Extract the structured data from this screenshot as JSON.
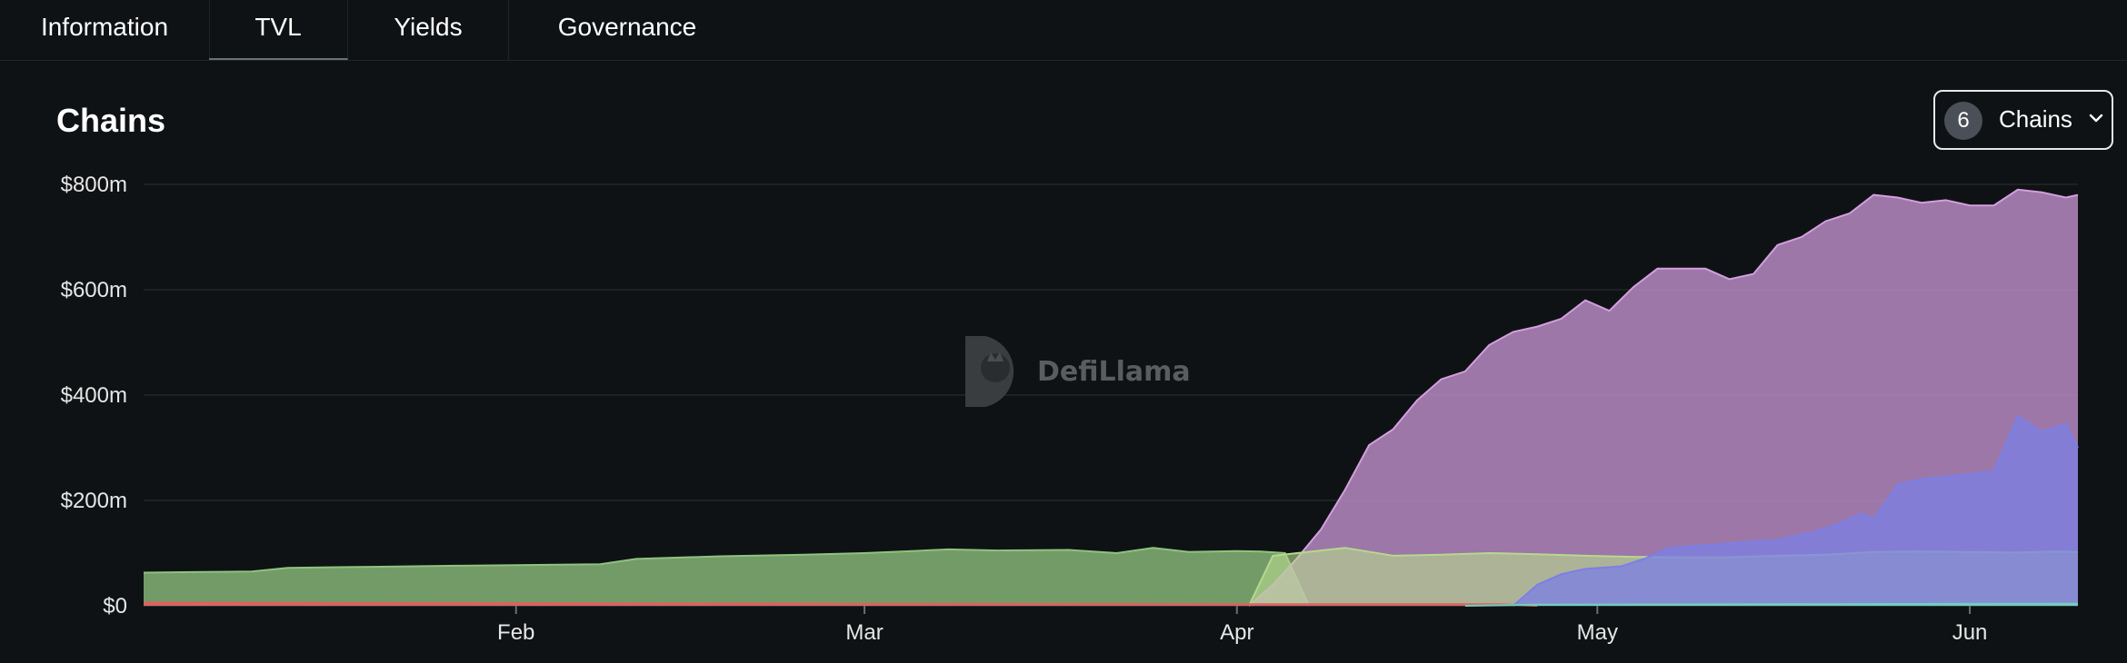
{
  "tabs": [
    {
      "label": "Information",
      "active": false
    },
    {
      "label": "TVL",
      "active": true
    },
    {
      "label": "Yields",
      "active": false
    },
    {
      "label": "Governance",
      "active": false
    }
  ],
  "chart_title": "Chains",
  "chains_selector": {
    "count": "6",
    "label": "Chains",
    "icon": "chevron-down-icon"
  },
  "watermark": "DefiLlama",
  "colors": {
    "background": "#0f1214",
    "grid": "#23272a",
    "series_green": "#8fc27f",
    "series_pink": "#d49ee0",
    "series_blue": "#7b7fe6",
    "series_lightgreen": "#b6d88e",
    "series_red": "#e06060",
    "series_teal": "#6fd0c0"
  },
  "chart_data": {
    "type": "area",
    "stacked": false,
    "x_axis": {
      "start": "2024-01-01",
      "end": "2024-06-10",
      "ticks": [
        "Feb",
        "Mar",
        "Apr",
        "May",
        "Jun"
      ],
      "tick_dates": [
        "2024-02-01",
        "2024-03-01",
        "2024-04-01",
        "2024-05-01",
        "2024-06-01"
      ]
    },
    "y_axis": {
      "ticks": [
        "$0",
        "$200m",
        "$400m",
        "$600m",
        "$800m"
      ],
      "tick_values": [
        0,
        200,
        400,
        600,
        800
      ],
      "units": "USD millions",
      "ylim": [
        0,
        800
      ]
    },
    "grid": true,
    "series": [
      {
        "color": "green",
        "points": [
          [
            "2024-01-01",
            63
          ],
          [
            "2024-01-05",
            64
          ],
          [
            "2024-01-10",
            65
          ],
          [
            "2024-01-13",
            72
          ],
          [
            "2024-01-20",
            74
          ],
          [
            "2024-01-27",
            76
          ],
          [
            "2024-02-01",
            77
          ],
          [
            "2024-02-08",
            79
          ],
          [
            "2024-02-11",
            89
          ],
          [
            "2024-02-18",
            94
          ],
          [
            "2024-02-25",
            97
          ],
          [
            "2024-03-01",
            100
          ],
          [
            "2024-03-05",
            104
          ],
          [
            "2024-03-08",
            107
          ],
          [
            "2024-03-12",
            105
          ],
          [
            "2024-03-18",
            106
          ],
          [
            "2024-03-22",
            100
          ],
          [
            "2024-03-25",
            110
          ],
          [
            "2024-03-28",
            102
          ],
          [
            "2024-04-01",
            104
          ],
          [
            "2024-04-03",
            103
          ],
          [
            "2024-04-05",
            100
          ],
          [
            "2024-04-07",
            0
          ]
        ]
      },
      {
        "color": "pink",
        "points": [
          [
            "2024-04-02",
            0
          ],
          [
            "2024-04-04",
            40
          ],
          [
            "2024-04-06",
            90
          ],
          [
            "2024-04-08",
            145
          ],
          [
            "2024-04-10",
            220
          ],
          [
            "2024-04-12",
            305
          ],
          [
            "2024-04-14",
            335
          ],
          [
            "2024-04-16",
            390
          ],
          [
            "2024-04-18",
            430
          ],
          [
            "2024-04-20",
            445
          ],
          [
            "2024-04-22",
            495
          ],
          [
            "2024-04-24",
            520
          ],
          [
            "2024-04-26",
            530
          ],
          [
            "2024-04-28",
            545
          ],
          [
            "2024-04-30",
            580
          ],
          [
            "2024-05-02",
            560
          ],
          [
            "2024-05-04",
            605
          ],
          [
            "2024-05-06",
            640
          ],
          [
            "2024-05-08",
            640
          ],
          [
            "2024-05-10",
            640
          ],
          [
            "2024-05-12",
            620
          ],
          [
            "2024-05-14",
            630
          ],
          [
            "2024-05-16",
            685
          ],
          [
            "2024-05-18",
            700
          ],
          [
            "2024-05-20",
            730
          ],
          [
            "2024-05-22",
            745
          ],
          [
            "2024-05-24",
            780
          ],
          [
            "2024-05-26",
            775
          ],
          [
            "2024-05-28",
            765
          ],
          [
            "2024-05-30",
            770
          ],
          [
            "2024-06-01",
            760
          ],
          [
            "2024-06-03",
            760
          ],
          [
            "2024-06-05",
            790
          ],
          [
            "2024-06-07",
            785
          ],
          [
            "2024-06-09",
            775
          ],
          [
            "2024-06-10",
            780
          ]
        ]
      },
      {
        "color": "lightgreen",
        "points": [
          [
            "2024-04-02",
            0
          ],
          [
            "2024-04-04",
            95
          ],
          [
            "2024-04-08",
            105
          ],
          [
            "2024-04-10",
            110
          ],
          [
            "2024-04-14",
            95
          ],
          [
            "2024-04-18",
            97
          ],
          [
            "2024-04-22",
            100
          ],
          [
            "2024-04-26",
            98
          ],
          [
            "2024-04-30",
            95
          ],
          [
            "2024-05-04",
            93
          ],
          [
            "2024-05-08",
            92
          ],
          [
            "2024-05-12",
            92
          ],
          [
            "2024-05-16",
            95
          ],
          [
            "2024-05-20",
            97
          ],
          [
            "2024-05-24",
            102
          ],
          [
            "2024-05-28",
            103
          ],
          [
            "2024-06-01",
            102
          ],
          [
            "2024-06-05",
            101
          ],
          [
            "2024-06-08",
            103
          ],
          [
            "2024-06-10",
            102
          ]
        ]
      },
      {
        "color": "blue",
        "points": [
          [
            "2024-04-24",
            0
          ],
          [
            "2024-04-26",
            40
          ],
          [
            "2024-04-28",
            60
          ],
          [
            "2024-04-30",
            70
          ],
          [
            "2024-05-03",
            75
          ],
          [
            "2024-05-05",
            90
          ],
          [
            "2024-05-07",
            110
          ],
          [
            "2024-05-10",
            115
          ],
          [
            "2024-05-13",
            120
          ],
          [
            "2024-05-16",
            125
          ],
          [
            "2024-05-19",
            140
          ],
          [
            "2024-05-21",
            155
          ],
          [
            "2024-05-23",
            175
          ],
          [
            "2024-05-24",
            165
          ],
          [
            "2024-05-26",
            230
          ],
          [
            "2024-05-28",
            240
          ],
          [
            "2024-05-30",
            245
          ],
          [
            "2024-06-01",
            250
          ],
          [
            "2024-06-03",
            255
          ],
          [
            "2024-06-05",
            360
          ],
          [
            "2024-06-07",
            330
          ],
          [
            "2024-06-09",
            345
          ],
          [
            "2024-06-10",
            300
          ]
        ]
      },
      {
        "color": "red",
        "points": [
          [
            "2024-01-01",
            6
          ],
          [
            "2024-02-01",
            5
          ],
          [
            "2024-03-01",
            4
          ],
          [
            "2024-04-01",
            3
          ],
          [
            "2024-04-23",
            3
          ],
          [
            "2024-04-26",
            0
          ]
        ]
      },
      {
        "color": "teal",
        "points": [
          [
            "2024-04-20",
            0
          ],
          [
            "2024-04-26",
            2
          ],
          [
            "2024-05-15",
            3
          ],
          [
            "2024-06-10",
            4
          ]
        ]
      }
    ]
  }
}
